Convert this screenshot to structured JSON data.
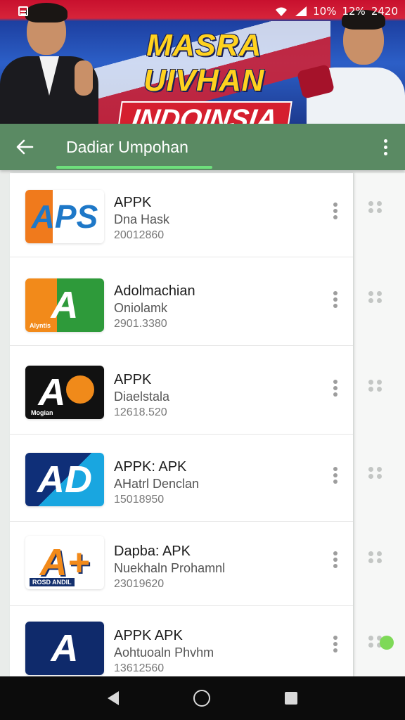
{
  "status_bar": {
    "wifi_icon": "wifi-icon",
    "signal_icon": "signal-icon",
    "texts": [
      "10%",
      "12%",
      "2420"
    ]
  },
  "banner": {
    "headline_line1": "MASRA UIVHAN",
    "headline_line2": "INDOINSIA",
    "colors": {
      "red": "#d51f2f",
      "blue": "#1d3fa0",
      "yellow": "#ffd21f"
    }
  },
  "app_bar": {
    "title": "Dadiar Umpohan",
    "back_icon": "arrow-left-icon",
    "more_icon": "more-vert-icon",
    "color": "#5a8a63",
    "indicator_color": "#6ee07c"
  },
  "apps": [
    {
      "name": "APPK",
      "subtitle": "Dna Hask",
      "version": "20012860",
      "icon_text": "APS",
      "icon_sub": ""
    },
    {
      "name": "Adolmachian",
      "subtitle": "Oniolamk",
      "version": "2901.3380",
      "icon_text": "A",
      "icon_sub": "Alyntis"
    },
    {
      "name": "APPK",
      "subtitle": "Diaelstala",
      "version": "12618.520",
      "icon_text": "A",
      "icon_sub": "Mogian"
    },
    {
      "name": "APPK: APK",
      "subtitle": "AHatrl Denclan",
      "version": "15018950",
      "icon_text": "AD",
      "icon_sub": ""
    },
    {
      "name": "Dapba: APK",
      "subtitle": "Nuekhaln Prohamnl",
      "version": "23019620",
      "icon_text": "A+",
      "icon_sub": "ROSD ANDIL"
    },
    {
      "name": "APPK APK",
      "subtitle": "Aohtuoaln Phvhm",
      "version": "13612560",
      "icon_text": "A",
      "icon_sub": ""
    }
  ],
  "nav_bar": {
    "back": "nav-back-icon",
    "home": "nav-home-icon",
    "recents": "nav-recents-icon"
  }
}
